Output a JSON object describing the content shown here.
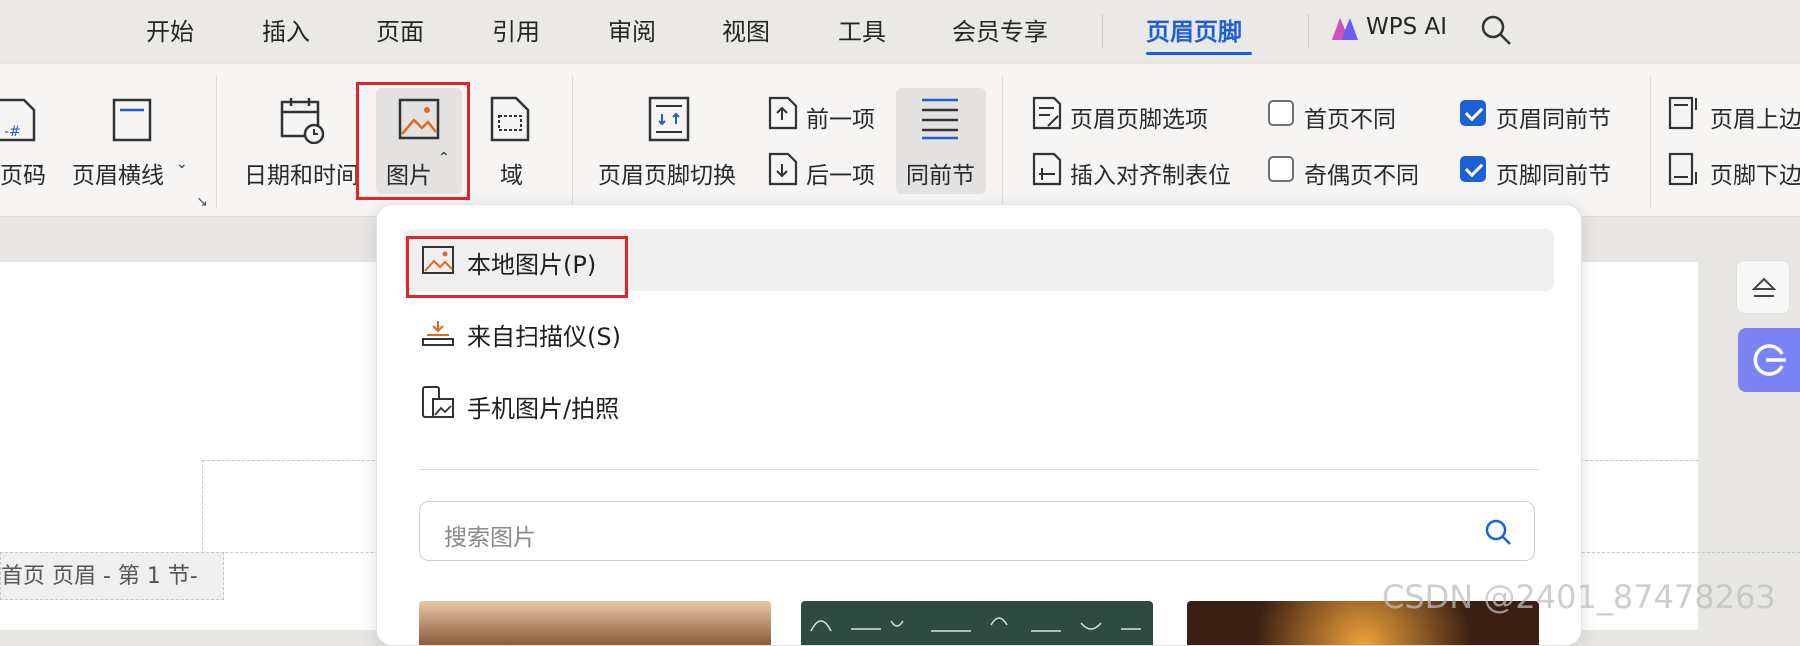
{
  "menu": {
    "items": [
      "开始",
      "插入",
      "页面",
      "引用",
      "审阅",
      "视图",
      "工具",
      "会员专享"
    ],
    "active": "页眉页脚",
    "ai_label": "WPS AI"
  },
  "ribbon": {
    "page_number_label": "页码",
    "header_line_label": "页眉横线",
    "date_time_label": "日期和时间",
    "picture_label": "图片",
    "field_label": "域",
    "switch_label": "页眉页脚切换",
    "prev_label": "前一项",
    "next_label": "后一项",
    "same_as_prev_label": "同前节",
    "hf_options_label": "页眉页脚选项",
    "insert_tab_label": "插入对齐制表位",
    "first_page_diff_label": "首页不同",
    "odd_even_diff_label": "奇偶页不同",
    "header_same_label": "页眉同前节",
    "footer_same_label": "页脚同前节",
    "header_top_label": "页眉上边",
    "footer_bottom_label": "页脚下边",
    "first_page_diff_checked": false,
    "odd_even_diff_checked": false,
    "header_same_checked": true,
    "footer_same_checked": true
  },
  "dropdown": {
    "local_picture": "本地图片(P)",
    "from_scanner": "来自扫描仪(S)",
    "phone_picture": "手机图片/拍照",
    "search_placeholder": "搜索图片"
  },
  "document": {
    "header_tag": "首页 页眉  - 第 1 节-"
  },
  "watermark": "CSDN @2401_87478263",
  "colors": {
    "accent": "#1f5fd6",
    "highlight_box": "#e0262b",
    "ai_button": "#7c83f2"
  }
}
